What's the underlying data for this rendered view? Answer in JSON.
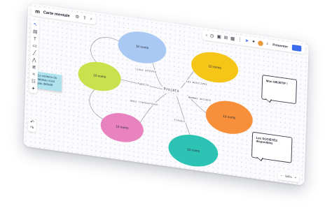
{
  "app": {
    "logo_text": "m",
    "title": "Carte mentale"
  },
  "topbar_left_icons": [
    {
      "name": "settings-icon",
      "glyph": "⚙"
    },
    {
      "name": "export-icon",
      "glyph": "⇪"
    },
    {
      "name": "search-icon",
      "glyph": "⌕"
    }
  ],
  "toolbar_right": {
    "icons": [
      {
        "name": "chevron-left-icon",
        "glyph": "‹"
      },
      {
        "name": "timer-icon",
        "glyph": "◷"
      },
      {
        "name": "frame-icon",
        "glyph": "▣"
      },
      {
        "name": "grid-icon",
        "glyph": "⊞"
      },
      {
        "name": "table-icon",
        "glyph": "▦"
      },
      {
        "name": "more-icon",
        "glyph": "⋮"
      },
      {
        "name": "cursor-icon",
        "glyph": "➤"
      },
      {
        "name": "celebrate-icon",
        "glyph": "✦"
      },
      {
        "name": "bell-icon",
        "glyph": "♪"
      }
    ],
    "present_label": "Présenter"
  },
  "left_tools": [
    {
      "name": "select-tool-icon",
      "glyph": "↖",
      "active": true
    },
    {
      "name": "templates-icon",
      "glyph": "▤"
    },
    {
      "name": "text-tool-icon",
      "glyph": "T"
    },
    {
      "name": "comment-icon",
      "glyph": "▭"
    },
    {
      "name": "pen-tool-icon",
      "glyph": "╱"
    },
    {
      "name": "shapes-tool-icon",
      "glyph": "⋀"
    },
    {
      "name": "lines-tool-icon",
      "glyph": "≣"
    },
    {
      "name": "frame-tool-icon",
      "glyph": "⌗"
    },
    {
      "name": "apps-icon",
      "glyph": "☷"
    },
    {
      "name": "add-icon",
      "glyph": "+"
    }
  ],
  "undo_tools": [
    {
      "name": "undo-icon",
      "glyph": "↶"
    },
    {
      "name": "redo-icon",
      "glyph": "↷"
    }
  ],
  "center_topic": "Projets",
  "nodes": [
    {
      "id": "node-blue",
      "label": "10 noms",
      "color": "#a9c8f3"
    },
    {
      "id": "node-yellow",
      "label": "10 noms",
      "color": "#f5c518"
    },
    {
      "id": "node-green",
      "label": "10 noms",
      "color": "#c8e14c"
    },
    {
      "id": "node-orange",
      "label": "10 noms",
      "color": "#f78f3b"
    },
    {
      "id": "node-pink",
      "label": "10 noms",
      "color": "#e983c0"
    },
    {
      "id": "node-teal",
      "label": "10 noms",
      "color": "#2cc3b5"
    }
  ],
  "edge_labels": [
    "Linux athlète",
    "Les musiciens",
    "Famille",
    "Hommes anciens",
    "Amis transversaux",
    "Travail"
  ],
  "sticky_note": "Le contenu du tableau n'est pas définitif",
  "callouts": [
    "Mon OBJETIF !",
    "Les SOCIÉTÉS disponibles"
  ],
  "zoom": {
    "minus": "−",
    "value": "54%",
    "plus": "+"
  }
}
